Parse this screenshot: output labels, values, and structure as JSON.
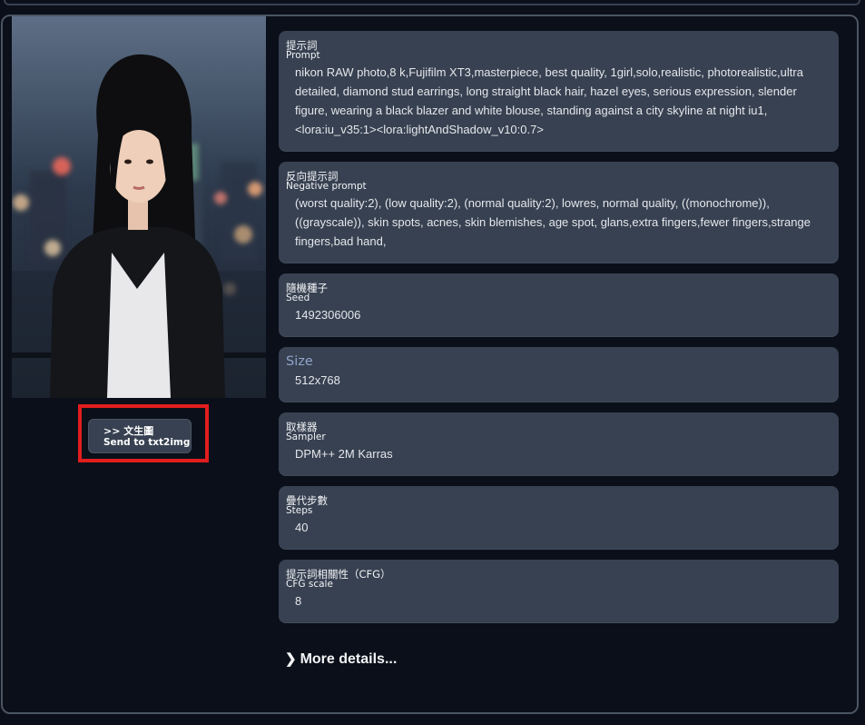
{
  "image": {
    "alt": "generated-portrait"
  },
  "send_button": {
    "line1": ">> 文生圖",
    "line2": "Send to txt2img"
  },
  "fields": {
    "prompt": {
      "label_zh": "提示詞",
      "label_en": "Prompt",
      "value": "nikon RAW photo,8 k,Fujifilm XT3,masterpiece, best quality, 1girl,solo,realistic, photorealistic,ultra detailed, diamond stud earrings, long straight black hair, hazel eyes, serious expression, slender figure, wearing a black blazer and white blouse, standing against a city skyline at night iu1, <lora:iu_v35:1><lora:lightAndShadow_v10:0.7>"
    },
    "negative_prompt": {
      "label_zh": "反向提示詞",
      "label_en": "Negative prompt",
      "value": "(worst quality:2), (low quality:2), (normal quality:2), lowres, normal quality, ((monochrome)), ((grayscale)), skin spots, acnes, skin blemishes, age spot, glans,extra fingers,fewer fingers,strange fingers,bad hand,"
    },
    "seed": {
      "label_zh": "隨機種子",
      "label_en": "Seed",
      "value": "1492306006"
    },
    "size": {
      "label": "Size",
      "value": "512x768"
    },
    "sampler": {
      "label_zh": "取樣器",
      "label_en": "Sampler",
      "value": "DPM++ 2M Karras"
    },
    "steps": {
      "label_zh": "疊代步數",
      "label_en": "Steps",
      "value": "40"
    },
    "cfg": {
      "label_zh": "提示詞相關性（CFG）",
      "label_en": "CFG scale",
      "value": "8"
    }
  },
  "more_details": {
    "icon": "chevron-right-icon",
    "label": "More details..."
  },
  "colors": {
    "background": "#0b0f19",
    "field_bg": "#374151",
    "highlight": "#e11d1d",
    "size_label": "#8fa4c8"
  }
}
